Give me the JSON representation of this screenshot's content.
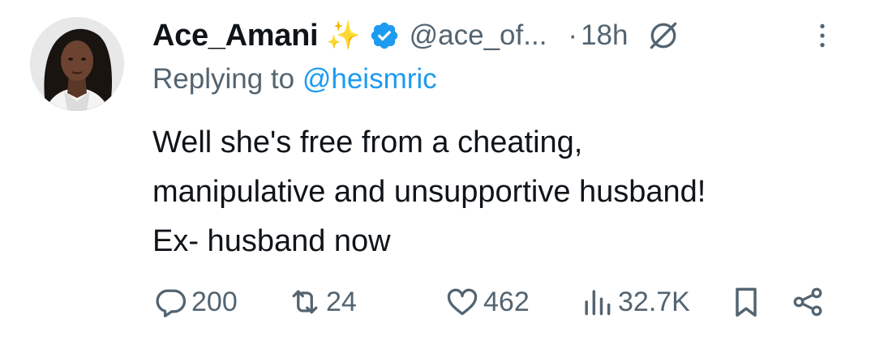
{
  "tweet": {
    "author_name": "Ace_Amani",
    "author_handle": "@ace_of...",
    "separator": "·",
    "time": "18h",
    "replying_label": "Replying to",
    "replying_to": "@heismric",
    "text_lines": [
      "Well she's free from a cheating,",
      "manipulative and unsupportive husband!",
      "Ex- husband now"
    ]
  },
  "actions": {
    "replies": "200",
    "retweets": "24",
    "likes": "462",
    "views": "32.7K"
  },
  "icons": {
    "sparkles": "sparkles-emoji",
    "verified": "verified-badge-icon",
    "mute": "mute-icon",
    "more": "more-vertical-icon",
    "reply": "reply-icon",
    "retweet": "retweet-icon",
    "like": "heart-icon",
    "views": "views-icon",
    "bookmark": "bookmark-icon",
    "share": "share-icon"
  },
  "colors": {
    "text": "#0f1419",
    "secondary": "#536471",
    "link": "#1d9bf0",
    "verified": "#1d9bf0"
  }
}
